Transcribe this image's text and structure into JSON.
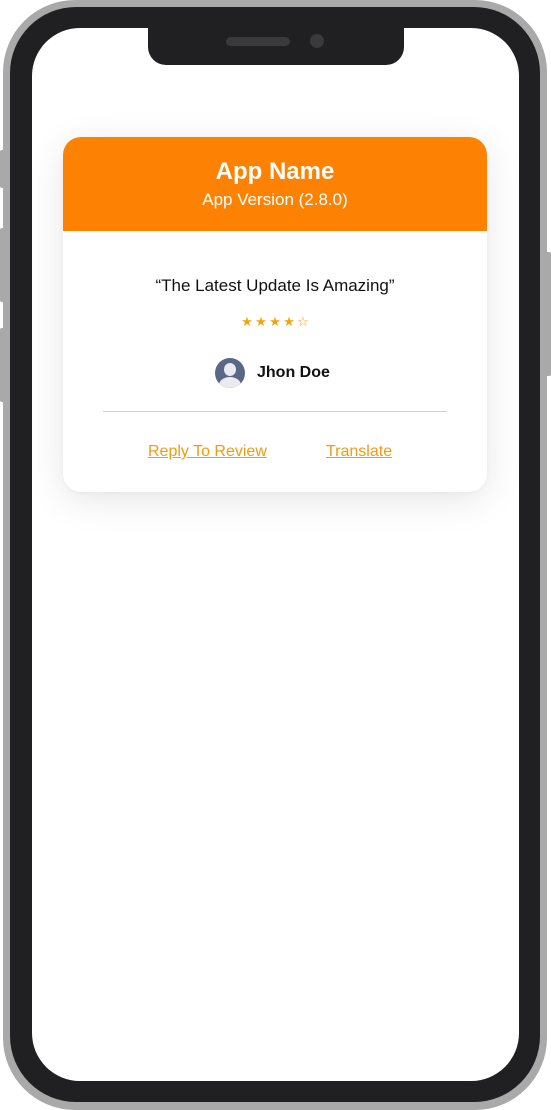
{
  "app": {
    "name": "App Name",
    "version": "App Version (2.8.0)"
  },
  "review": {
    "quote": "“The Latest Update Is Amazing”",
    "rating": 4,
    "rating_max": 5,
    "author": "Jhon Doe"
  },
  "actions": {
    "reply_label": "Reply To Review",
    "translate_label": "Translate"
  },
  "colors": {
    "accent": "#fd8102",
    "star": "#f6a313",
    "link": "#f59a0e",
    "avatar": "#5a6886"
  },
  "icons": {
    "avatar": "user-avatar-icon",
    "star": "star-icon"
  }
}
